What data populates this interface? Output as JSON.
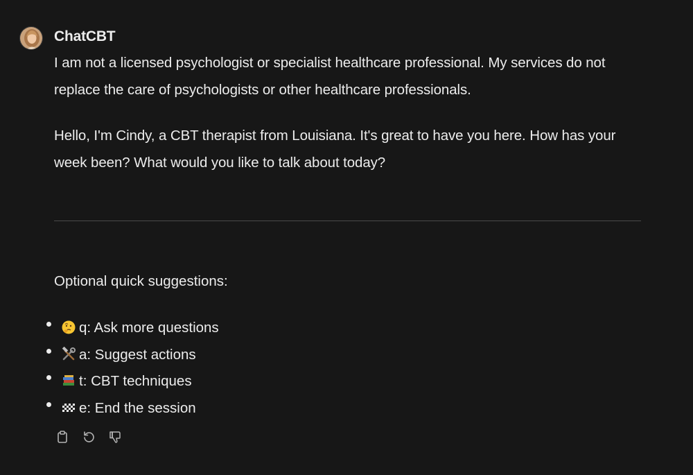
{
  "message": {
    "sender": "ChatCBT",
    "paragraphs": [
      "I am not a licensed psychologist or specialist healthcare professional. My services do not replace the care of psychologists or other healthcare professionals.",
      "Hello, I'm Cindy, a CBT therapist from Louisiana. It's great to have you here. How has your week been? What would you like to talk about today?"
    ],
    "suggestions_title": "Optional quick suggestions:",
    "suggestions": [
      {
        "icon": "thinking-face-icon",
        "text": "q: Ask more questions"
      },
      {
        "icon": "hammer-and-wrench-icon",
        "text": "a: Suggest actions"
      },
      {
        "icon": "books-icon",
        "text": "t: CBT techniques"
      },
      {
        "icon": "chequered-flag-icon",
        "text": "e: End the session"
      }
    ]
  },
  "actions": [
    {
      "icon": "clipboard-icon",
      "label": "copy"
    },
    {
      "icon": "regenerate-icon",
      "label": "regenerate"
    },
    {
      "icon": "thumbs-down-icon",
      "label": "bad response"
    }
  ],
  "colors": {
    "background": "#171717",
    "text": "#ececec",
    "divider": "#4a4a4a",
    "icon": "#b4b4b4"
  }
}
